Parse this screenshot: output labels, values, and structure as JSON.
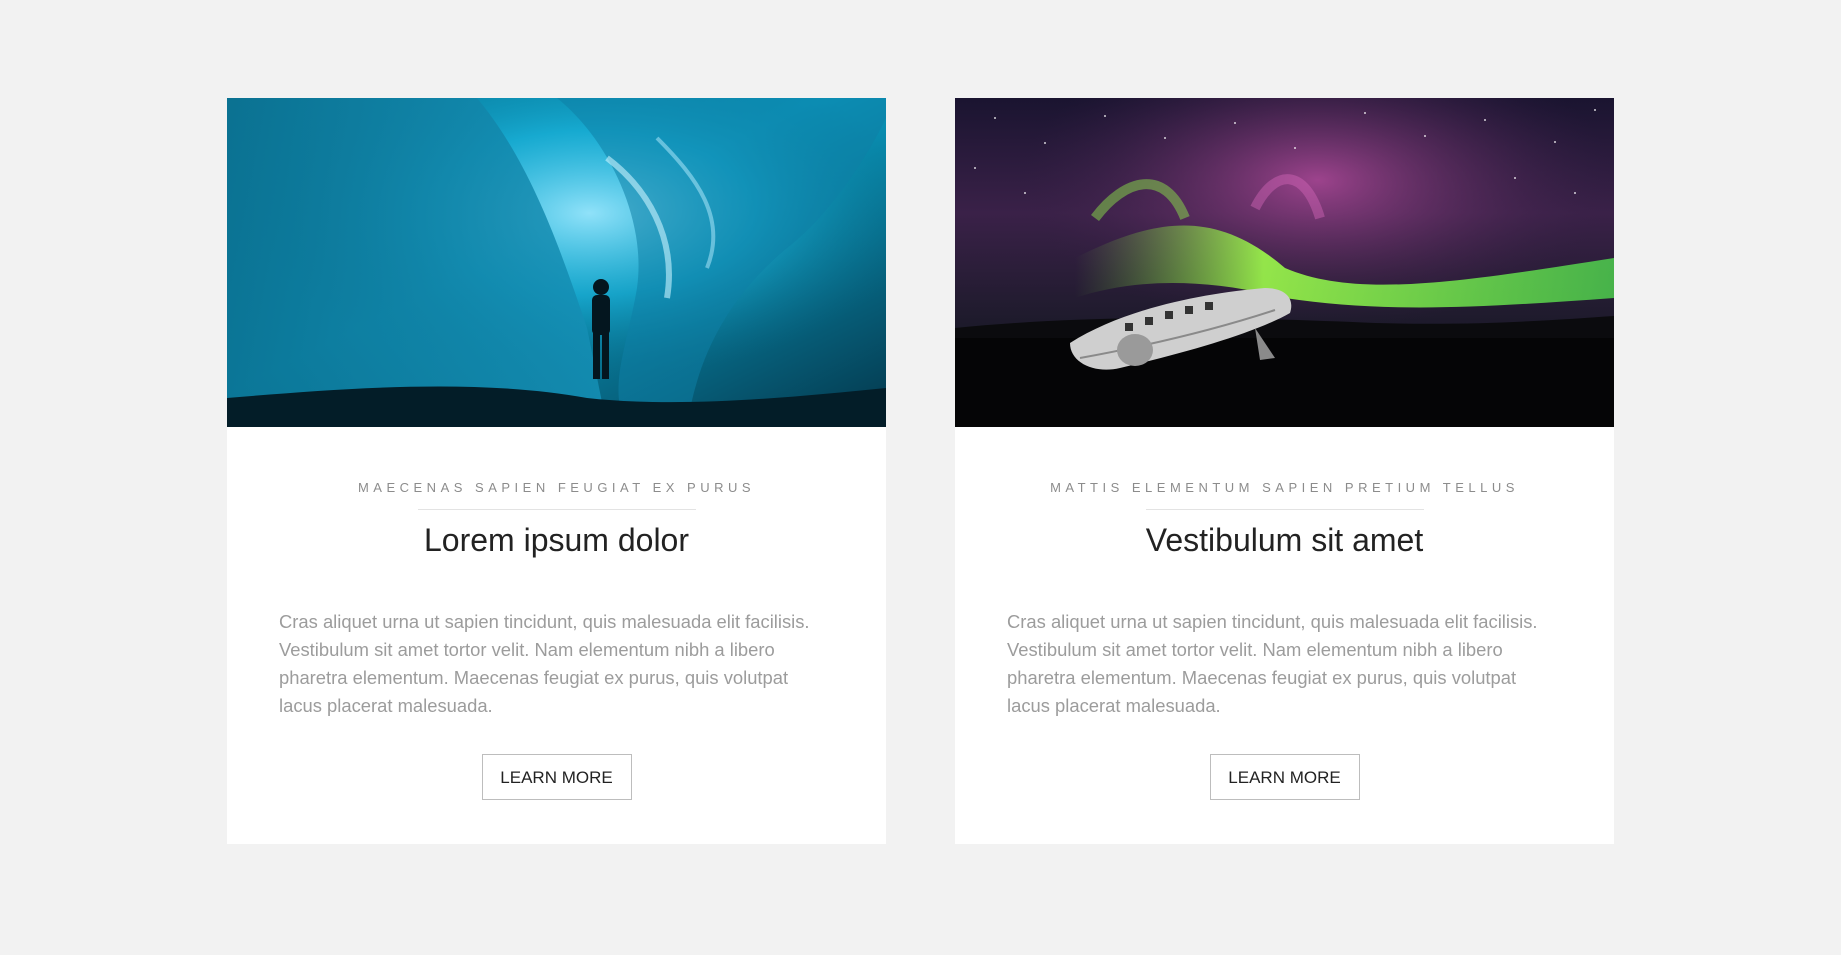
{
  "cards": [
    {
      "image": {
        "alt": "ice-cave-photo"
      },
      "eyebrow": "MAECENAS SAPIEN FEUGIAT EX PURUS",
      "title": "Lorem ipsum dolor",
      "description": "Cras aliquet urna ut sapien tincidunt, quis malesuada elit facilisis. Vestibulum sit amet tortor velit. Nam elementum nibh a libero pharetra elementum. Maecenas feugiat ex purus, quis volutpat lacus placerat malesuada.",
      "button_label": "LEARN MORE"
    },
    {
      "image": {
        "alt": "aurora-plane-wreck-photo"
      },
      "eyebrow": "MATTIS ELEMENTUM SAPIEN PRETIUM TELLUS",
      "title": "Vestibulum sit amet",
      "description": "Cras aliquet urna ut sapien tincidunt, quis malesuada elit facilisis. Vestibulum sit amet tortor velit. Nam elementum nibh a libero pharetra elementum. Maecenas feugiat ex purus, quis volutpat lacus placerat malesuada.",
      "button_label": "LEARN MORE"
    }
  ],
  "colors": {
    "page_background": "#f2f2f2",
    "card_background": "#ffffff",
    "title_text": "#222222",
    "muted_text": "#9c9c9c",
    "button_border": "#bdbdbd"
  }
}
